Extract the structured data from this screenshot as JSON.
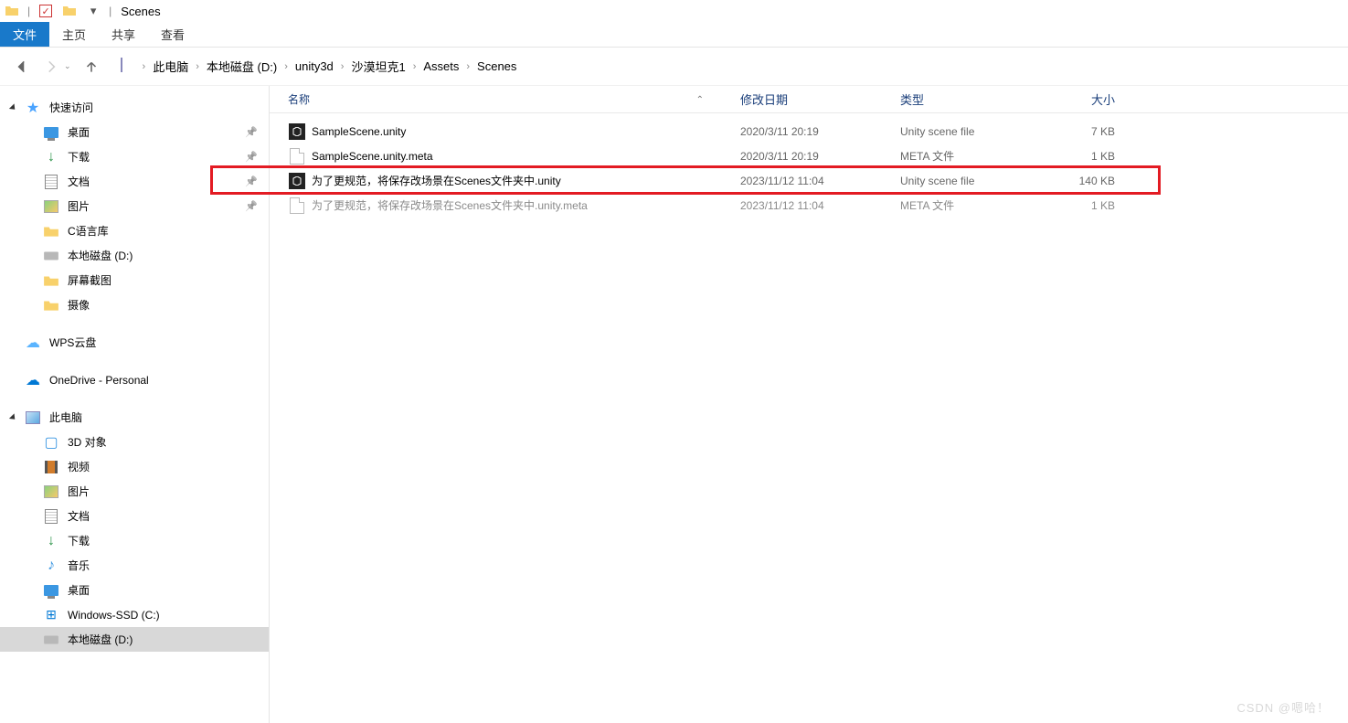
{
  "title_bar": {
    "window_title": "Scenes"
  },
  "ribbon": {
    "file": "文件",
    "home": "主页",
    "share": "共享",
    "view": "查看"
  },
  "breadcrumb": [
    "此电脑",
    "本地磁盘 (D:)",
    "unity3d",
    "沙漠坦克1",
    "Assets",
    "Scenes"
  ],
  "sidebar": {
    "quick_access": "快速访问",
    "quick_items": [
      {
        "label": "桌面",
        "icon": "monitor",
        "pinned": true
      },
      {
        "label": "下载",
        "icon": "down",
        "pinned": true
      },
      {
        "label": "文档",
        "icon": "doclines",
        "pinned": true
      },
      {
        "label": "图片",
        "icon": "pic",
        "pinned": true
      },
      {
        "label": "C语言库",
        "icon": "folder",
        "pinned": false
      },
      {
        "label": "本地磁盘 (D:)",
        "icon": "disk",
        "pinned": false
      },
      {
        "label": "屏幕截图",
        "icon": "folder",
        "pinned": false
      },
      {
        "label": "摄像",
        "icon": "folder",
        "pinned": false
      }
    ],
    "wps": "WPS云盘",
    "onedrive": "OneDrive - Personal",
    "this_pc": "此电脑",
    "pc_items": [
      {
        "label": "3D 对象",
        "icon": "3d"
      },
      {
        "label": "视频",
        "icon": "film"
      },
      {
        "label": "图片",
        "icon": "pic"
      },
      {
        "label": "文档",
        "icon": "doclines"
      },
      {
        "label": "下载",
        "icon": "down"
      },
      {
        "label": "音乐",
        "icon": "music"
      },
      {
        "label": "桌面",
        "icon": "monitor"
      },
      {
        "label": "Windows-SSD (C:)",
        "icon": "winssd"
      },
      {
        "label": "本地磁盘 (D:)",
        "icon": "disk"
      }
    ]
  },
  "columns": {
    "name": "名称",
    "date": "修改日期",
    "type": "类型",
    "size": "大小"
  },
  "files": [
    {
      "name": "SampleScene.unity",
      "date": "2020/3/11 20:19",
      "type": "Unity scene file",
      "size": "7 KB",
      "icon": "unity",
      "muted": false
    },
    {
      "name": "SampleScene.unity.meta",
      "date": "2020/3/11 20:19",
      "type": "META 文件",
      "size": "1 KB",
      "icon": "doc",
      "muted": false
    },
    {
      "name": "为了更规范，将保存改场景在Scenes文件夹中.unity",
      "date": "2023/11/12 11:04",
      "type": "Unity scene file",
      "size": "140 KB",
      "icon": "unity",
      "muted": false,
      "highlighted": true
    },
    {
      "name": "为了更规范，将保存改场景在Scenes文件夹中.unity.meta",
      "date": "2023/11/12 11:04",
      "type": "META 文件",
      "size": "1 KB",
      "icon": "doc",
      "muted": true
    }
  ],
  "watermark": "CSDN @嗯哈！"
}
